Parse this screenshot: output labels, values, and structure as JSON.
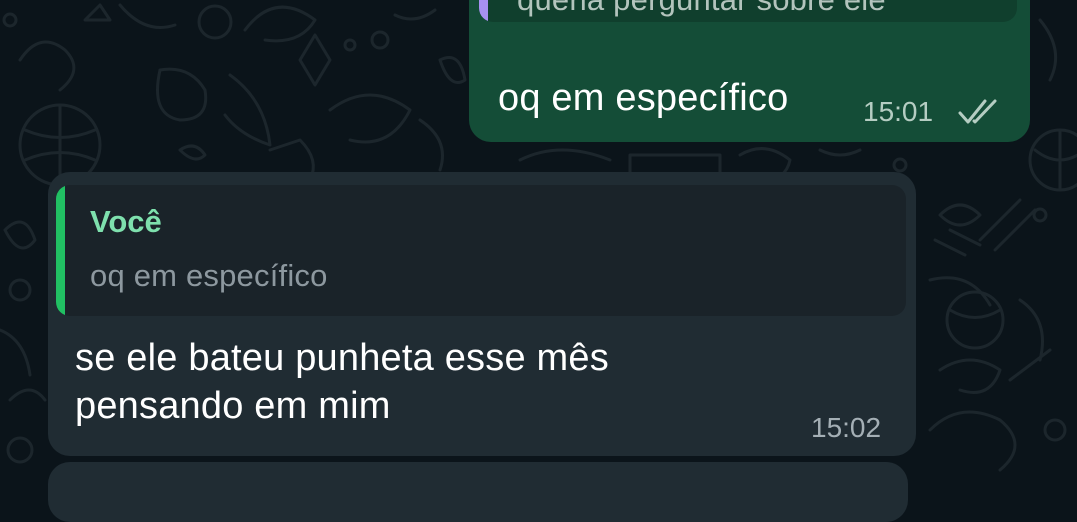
{
  "wallpaper": {
    "background_color": "#0b141a",
    "doodle_color": "#1c262c"
  },
  "messages": [
    {
      "direction": "outgoing",
      "bubble_color": "#144d37",
      "quote": {
        "text": "queria perguntar sobre ele",
        "bar_color": "#a791f0"
      },
      "text": "oq em específico",
      "time": "15:01",
      "status_icon": "double-check-icon"
    },
    {
      "direction": "incoming",
      "bubble_color": "#202c33",
      "quote": {
        "author": "Você",
        "text": "oq em específico",
        "bar_color": "#21c063",
        "author_color": "#7ee0ad"
      },
      "text_lines": [
        "se ele bateu punheta esse mês",
        "pensando em mim"
      ],
      "time": "15:02"
    }
  ]
}
